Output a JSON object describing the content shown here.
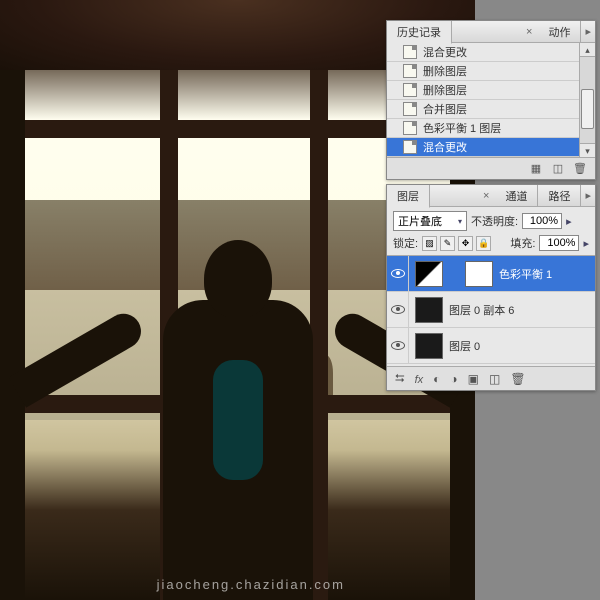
{
  "watermark": "jiaocheng.chazidian.com",
  "history_panel": {
    "tab_history": "历史记录",
    "tab_actions": "动作",
    "items": [
      {
        "label": "混合更改",
        "selected": false
      },
      {
        "label": "删除图层",
        "selected": false
      },
      {
        "label": "删除图层",
        "selected": false
      },
      {
        "label": "合并图层",
        "selected": false
      },
      {
        "label": "色彩平衡 1 图层",
        "selected": false
      },
      {
        "label": "混合更改",
        "selected": true
      }
    ]
  },
  "layers_panel": {
    "tab_layers": "图层",
    "tab_channels": "通道",
    "tab_paths": "路径",
    "blend_mode": "正片叠底",
    "opacity_label": "不透明度:",
    "opacity_value": "100%",
    "lock_label": "锁定:",
    "fill_label": "填充:",
    "fill_value": "100%",
    "layers": [
      {
        "name": "色彩平衡 1",
        "visible": true,
        "selected": true,
        "type": "adjustment"
      },
      {
        "name": "图层 0 副本 6",
        "visible": true,
        "selected": false,
        "type": "image"
      },
      {
        "name": "图层 0",
        "visible": true,
        "selected": false,
        "type": "image"
      }
    ]
  }
}
